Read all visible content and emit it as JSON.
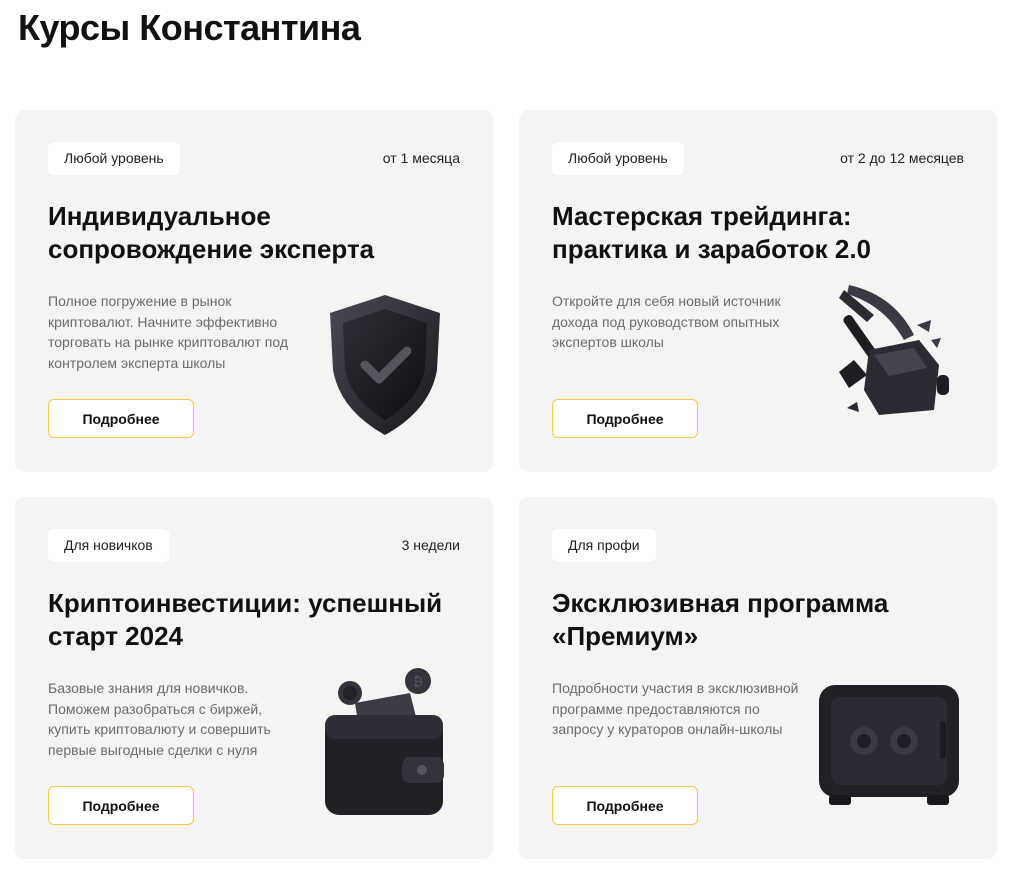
{
  "page": {
    "title": "Курсы Константина"
  },
  "cards": [
    {
      "level": "Любой уровень",
      "duration": "от 1 месяца",
      "title": "Индивидуальное сопровождение эксперта",
      "description": "Полное погружение в рынок криптовалют. Начните эффективно торговать на рынке криптовалют под контролем эксперта школы",
      "button": "Подробнее",
      "icon": "shield-check-icon"
    },
    {
      "level": "Любой уровень",
      "duration": "от 2 до 12 месяцев",
      "title": "Мастерская трейдинга: практика и заработок 2.0",
      "description": "Откройте для себя новый источник дохода под руководством опытных экспертов школы",
      "button": "Подробнее",
      "icon": "pickaxe-icon"
    },
    {
      "level": "Для новичков",
      "duration": "3 недели",
      "title": "Криптоинвестиции: успешный старт 2024",
      "description": "Базовые знания для новичков. Поможем разобраться с биржей, купить криптовалюту и совершить первые выгодные сделки с нуля",
      "button": "Подробнее",
      "icon": "wallet-icon"
    },
    {
      "level": "Для профи",
      "duration": "",
      "title": "Эксклюзивная программа «Премиум»",
      "description": "Подробности участия в эксклюзивной программе предоставляются по запросу у кураторов онлайн-школы",
      "button": "Подробнее",
      "icon": "safe-icon"
    }
  ],
  "colors": {
    "card_bg": "#f4f4f4",
    "button_border": "#f2c94c",
    "accent_dark": "#2a2a33"
  }
}
